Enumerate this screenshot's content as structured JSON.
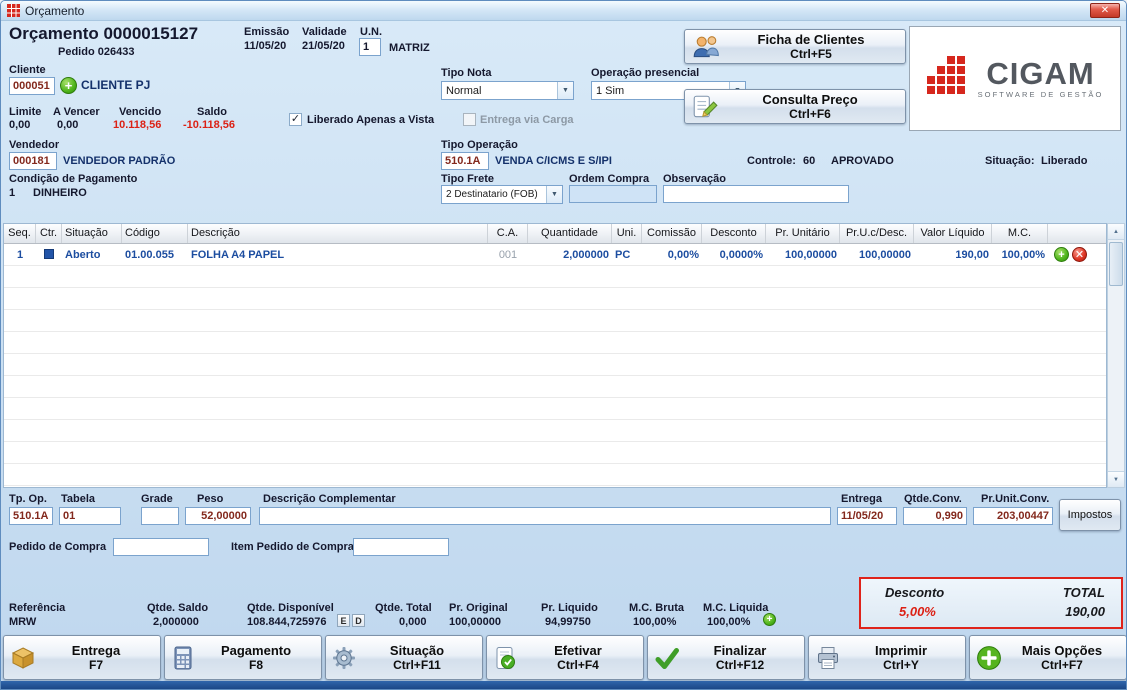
{
  "window": {
    "title": "Orçamento"
  },
  "icons": {
    "check": "✓",
    "close": "✕",
    "dropdown_arrow": "▼",
    "plus": "+",
    "remove": "✕",
    "scroll_up": "▲",
    "scroll_down": "▼"
  },
  "header": {
    "title": "Orçamento 0000015127",
    "pedido": "Pedido 026433",
    "emissao_label": "Emissão",
    "emissao_value": "11/05/20",
    "validade_label": "Validade",
    "validade_value": "21/05/20",
    "un_label": "U.N.",
    "un_value": "1",
    "un_name": "MATRIZ",
    "tipo_nota_label": "Tipo Nota",
    "tipo_nota_value": "Normal",
    "operacao_presencial_label": "Operação presencial",
    "operacao_presencial_value": "1 Sim",
    "cliente_label": "Cliente",
    "cliente_code": "000051",
    "cliente_name": "CLIENTE PJ",
    "limite_label": "Limite",
    "limite_value": "0,00",
    "a_vencer_label": "A Vencer",
    "a_vencer_value": "0,00",
    "vencido_label": "Vencido",
    "vencido_value": "10.118,56",
    "saldo_label": "Saldo",
    "saldo_value": "-10.118,56",
    "liberado_checkbox_label": "Liberado Apenas a Vista",
    "entrega_carga_checkbox_label": "Entrega via Carga",
    "ficha_clientes_label": "Ficha de Clientes",
    "ficha_clientes_shortcut": "Ctrl+F5",
    "consulta_preco_label": "Consulta Preço",
    "consulta_preco_shortcut": "Ctrl+F6",
    "logo_text": "CIGAM",
    "logo_subtext": "SOFTWARE DE GESTÃO"
  },
  "vendedor": {
    "label": "Vendedor",
    "code": "000181",
    "name": "VENDEDOR PADRÃO"
  },
  "tipo_operacao": {
    "label": "Tipo Operação",
    "code": "510.1A",
    "name": "VENDA C/ICMS E S/IPI"
  },
  "controle": {
    "label": "Controle:",
    "value": "60",
    "status": "APROVADO"
  },
  "situacao": {
    "label": "Situação:",
    "value": "Liberado"
  },
  "condicao_pagamento": {
    "label": "Condição de Pagamento",
    "code": "1",
    "name": "DINHEIRO"
  },
  "tipo_frete": {
    "label": "Tipo Frete",
    "value": "2 Destinatario (FOB)"
  },
  "ordem_compra": {
    "label": "Ordem Compra",
    "value": ""
  },
  "observacao": {
    "label": "Observação",
    "value": ""
  },
  "grid": {
    "columns": [
      "Seq.",
      "Ctr.",
      "Situação",
      "Código",
      "Descrição",
      "C.A.",
      "Quantidade",
      "Uni.",
      "Comissão",
      "Desconto",
      "Pr. Unitário",
      "Pr.U.c/Desc.",
      "Valor Líquido",
      "M.C."
    ],
    "rows": [
      {
        "seq": "1",
        "situacao": "Aberto",
        "codigo": "01.00.055",
        "descricao": "FOLHA A4 PAPEL",
        "ca": "001",
        "quantidade": "2,000000",
        "uni": "PC",
        "comissao": "0,00%",
        "desconto": "0,0000%",
        "pr_unitario": "100,00000",
        "pr_uc_desc": "100,00000",
        "valor_liquido": "190,00",
        "mc": "100,00%"
      }
    ]
  },
  "detail": {
    "tp_op_label": "Tp. Op.",
    "tp_op_value": "510.1A",
    "tabela_label": "Tabela",
    "tabela_value": "01",
    "grade_label": "Grade",
    "grade_value": "",
    "peso_label": "Peso",
    "peso_value": "52,00000",
    "descricao_complementar_label": "Descrição Complementar",
    "descricao_complementar_value": "",
    "entrega_label": "Entrega",
    "entrega_value": "11/05/20",
    "qtde_conv_label": "Qtde.Conv.",
    "qtde_conv_value": "0,990",
    "pr_unit_conv_label": "Pr.Unit.Conv.",
    "pr_unit_conv_value": "203,00447",
    "impostos_button": "Impostos",
    "pedido_compra_label": "Pedido de Compra",
    "pedido_compra_value": "",
    "item_pedido_compra_label": "Item Pedido de Compra",
    "item_pedido_compra_value": ""
  },
  "totals": {
    "desconto_label": "Desconto",
    "desconto_value": "5,00%",
    "total_label": "TOTAL",
    "total_value": "190,00"
  },
  "footer_info": {
    "referencia_label": "Referência",
    "referencia_value": "MRW",
    "qtde_saldo_label": "Qtde. Saldo",
    "qtde_saldo_value": "2,000000",
    "qtde_disponivel_label": "Qtde. Disponível",
    "qtde_disponivel_value": "108.844,725976",
    "qtde_disponivel_flags": [
      "E",
      "D"
    ],
    "qtde_total_label": "Qtde. Total",
    "qtde_total_value": "0,000",
    "pr_original_label": "Pr. Original",
    "pr_original_value": "100,00000",
    "pr_liquido_label": "Pr. Liquido",
    "pr_liquido_value": "94,99750",
    "mc_bruta_label": "M.C. Bruta",
    "mc_bruta_value": "100,00%",
    "mc_liquida_label": "M.C. Liquida",
    "mc_liquida_value": "100,00%"
  },
  "action_buttons": [
    {
      "label": "Entrega",
      "shortcut": "F7"
    },
    {
      "label": "Pagamento",
      "shortcut": "F8"
    },
    {
      "label": "Situação",
      "shortcut": "Ctrl+F11"
    },
    {
      "label": "Efetivar",
      "shortcut": "Ctrl+F4"
    },
    {
      "label": "Finalizar",
      "shortcut": "Ctrl+F12"
    },
    {
      "label": "Imprimir",
      "shortcut": "Ctrl+Y"
    },
    {
      "label": "Mais Opções",
      "shortcut": "Ctrl+F7"
    }
  ],
  "colors": {
    "accent_red": "#df231b",
    "brand_red": "#d6281e",
    "grid_text_navy": "#1c4da0",
    "field_text_maroon": "#83281c",
    "window_blue": "#cadff2"
  }
}
